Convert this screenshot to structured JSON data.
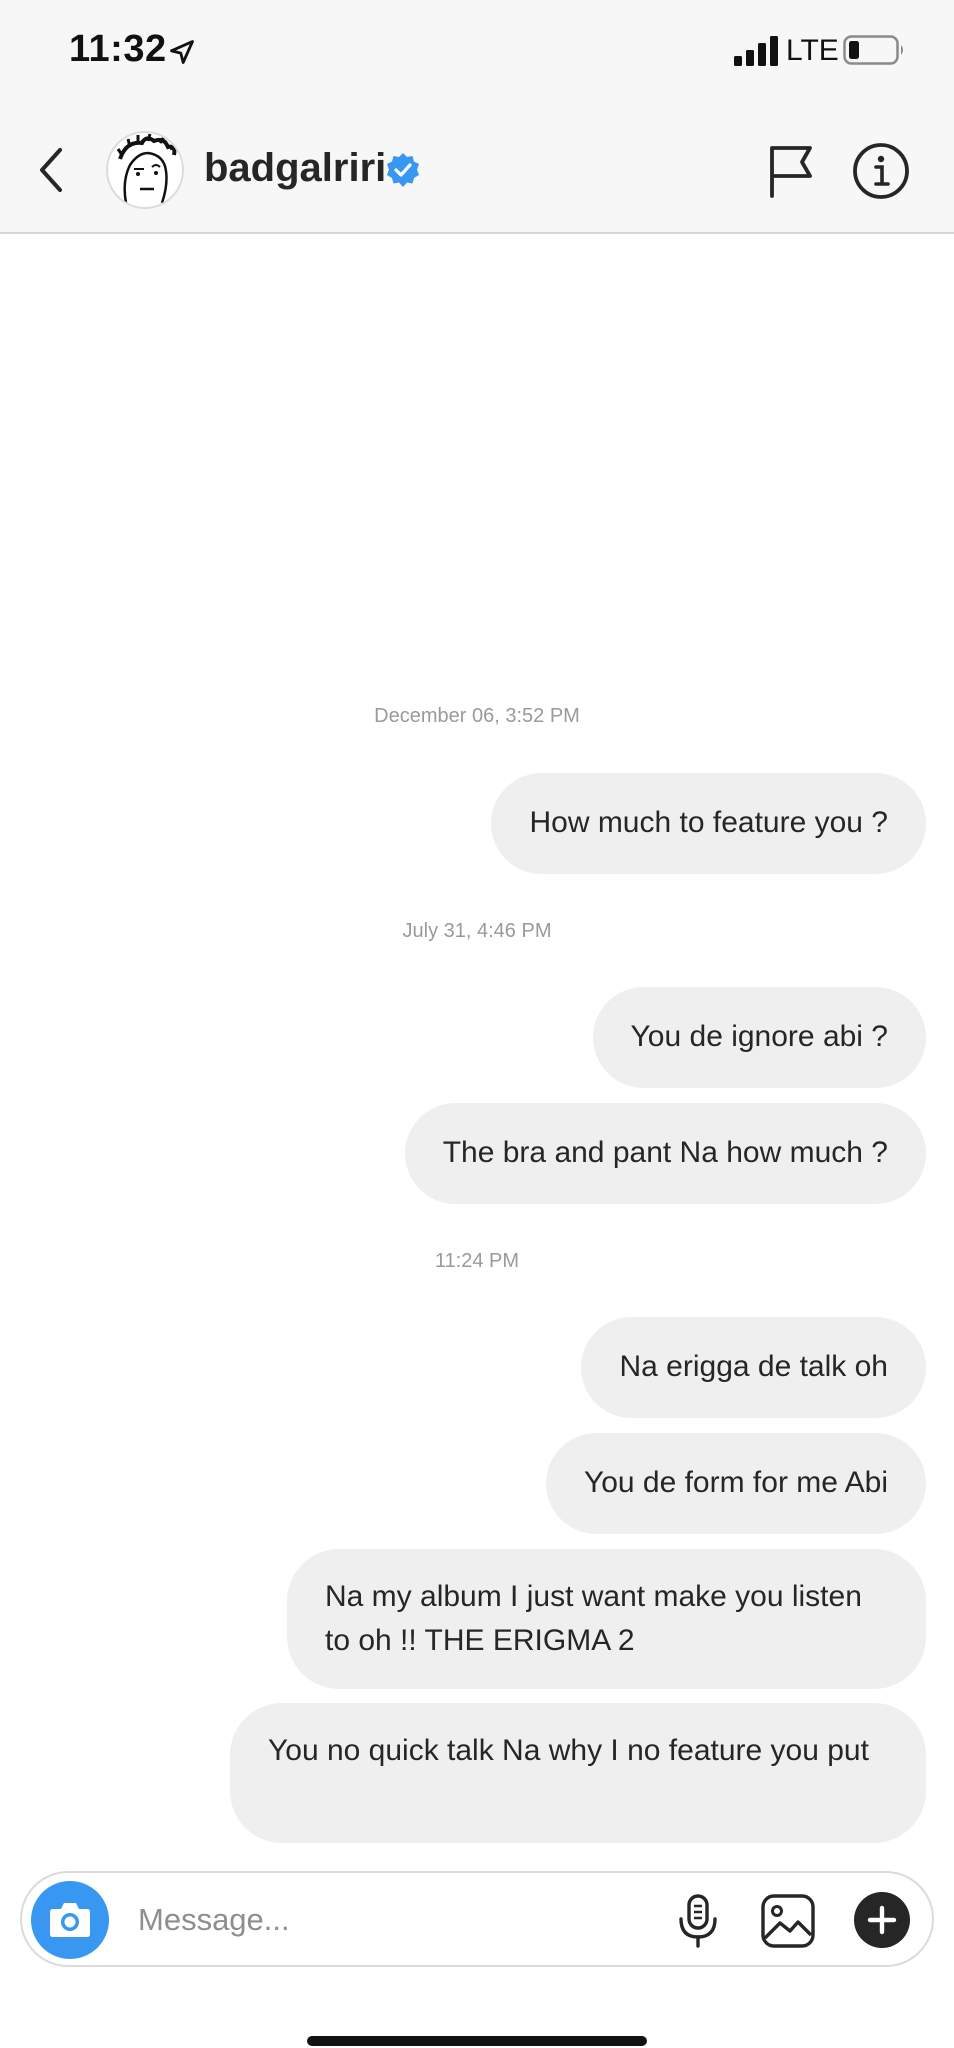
{
  "status_bar": {
    "time": "11:32",
    "network": "LTE"
  },
  "header": {
    "username": "badgalriri",
    "verified": true,
    "accent_color": "#3897f0"
  },
  "conversation": [
    {
      "type": "timestamp",
      "text": "December 06, 3:52 PM"
    },
    {
      "type": "message",
      "text": "How much to feature you ?"
    },
    {
      "type": "timestamp",
      "text": "July 31, 4:46 PM"
    },
    {
      "type": "message",
      "text": "You de ignore abi ?"
    },
    {
      "type": "message",
      "text": "The bra and pant Na how much ?"
    },
    {
      "type": "timestamp",
      "text": "11:24 PM"
    },
    {
      "type": "message",
      "text": "Na erigga de talk oh"
    },
    {
      "type": "message",
      "text": "You de form for me Abi"
    },
    {
      "type": "message",
      "text": "Na my album I just want make you listen to oh !! THE ERIGMA 2"
    },
    {
      "type": "message",
      "text": "You no quick talk Na why I no feature you put"
    }
  ],
  "composer": {
    "placeholder": "Message...",
    "icons": [
      "camera-icon",
      "microphone-icon",
      "gallery-icon",
      "plus-icon"
    ]
  },
  "colors": {
    "bubble_bg": "#efefef",
    "header_bg": "#f7f7f7",
    "text": "#262626",
    "timestamp": "#9a9a9a",
    "camera_button": "#3897f0"
  }
}
